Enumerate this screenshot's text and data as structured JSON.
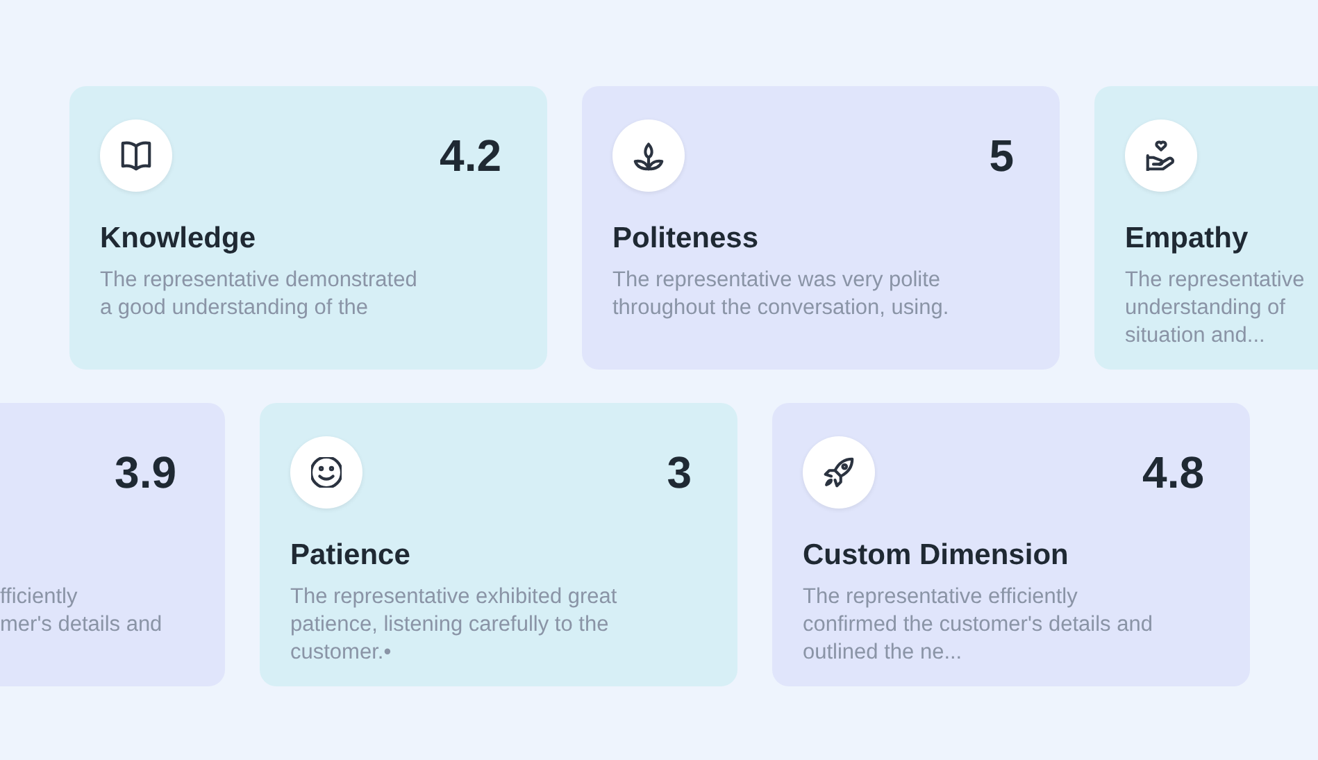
{
  "rows": [
    {
      "cards": [
        {
          "kind": "full",
          "title": "Knowledge",
          "score": "4.2",
          "description_lines": [
            "The representative demonstrated",
            "a good understanding of the"
          ]
        },
        {
          "kind": "full",
          "title": "Politeness",
          "score": "5",
          "description_lines": [
            "The representative was very polite",
            "throughout the conversation, using."
          ]
        },
        {
          "kind": "cut-right",
          "title": "Empathy",
          "description_lines": [
            "The representative",
            "understanding of",
            "situation and..."
          ]
        }
      ]
    },
    {
      "cards": [
        {
          "kind": "cut-left",
          "score": "3.9",
          "description_lines": [
            "fficiently",
            "mer's details and"
          ]
        },
        {
          "kind": "full",
          "title": "Patience",
          "score": "3",
          "description_lines": [
            "The representative exhibited great",
            "patience, listening carefully to the",
            "customer.•"
          ]
        },
        {
          "kind": "full",
          "title": "Custom Dimension",
          "score": "4.8",
          "description_lines": [
            "The representative efficiently",
            "confirmed the customer's details and",
            "outlined the ne..."
          ]
        }
      ]
    }
  ]
}
